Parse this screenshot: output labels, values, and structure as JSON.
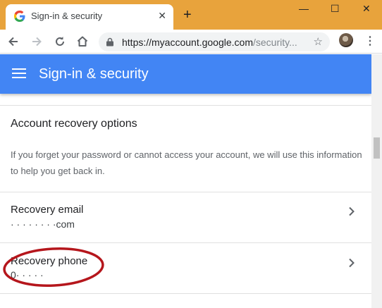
{
  "browser": {
    "tab_title": "Sign-in & security",
    "tab_close": "✕",
    "new_tab": "+",
    "window_minimize": "—",
    "window_maximize": "☐",
    "window_close": "✕",
    "url_host": "https://myaccount.google.com",
    "url_path": "/security...",
    "star": "☆",
    "menu": "⋮"
  },
  "appbar": {
    "title": "Sign-in & security",
    "color": "#4285f4"
  },
  "section": {
    "title": "Account recovery options",
    "description": "If you forget your password or cannot access your account, we will use this information to help you get back in."
  },
  "rows": [
    {
      "label": "Recovery email",
      "value": "·  ·  ·   ·   ·   ·  ·  ·com"
    },
    {
      "label": "Recovery phone",
      "value": "0·   ·   ·  ·    ·"
    }
  ],
  "annotation": {
    "color": "#b5161c"
  }
}
